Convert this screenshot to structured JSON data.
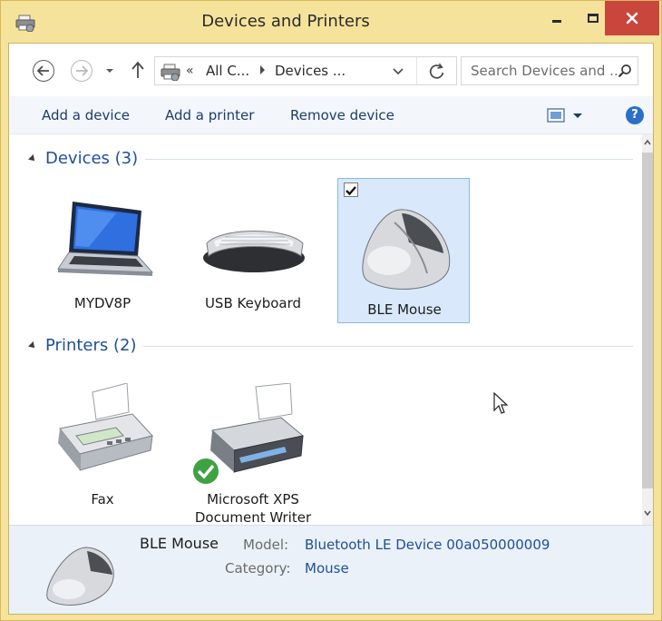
{
  "window": {
    "title": "Devices and Printers",
    "icons": [
      "devices-printers-icon",
      "minimize-icon",
      "maximize-icon",
      "close-icon"
    ],
    "close_color": "#c9463d",
    "frame_color": "#f6e39b"
  },
  "navigation": {
    "address_overflow": "«",
    "crumb_1": "All C...",
    "crumb_2": "Devices ...",
    "search_placeholder": "Search Devices and ..."
  },
  "commands": {
    "add_device": "Add a device",
    "add_printer": "Add a printer",
    "remove_device": "Remove device",
    "help_label": "?"
  },
  "groups": [
    {
      "label": "Devices (3)",
      "items": [
        {
          "label": "MYDV8P",
          "icon": "laptop-icon",
          "selected": false
        },
        {
          "label": "USB Keyboard",
          "icon": "keyboard-icon",
          "selected": false
        },
        {
          "label": "BLE Mouse",
          "icon": "mouse-icon",
          "selected": true
        }
      ]
    },
    {
      "label": "Printers (2)",
      "items": [
        {
          "label": "Fax",
          "icon": "fax-icon",
          "selected": false
        },
        {
          "label_line1": "Microsoft XPS",
          "label_line2": "Document Writer",
          "icon": "printer-icon",
          "default": true
        }
      ]
    }
  ],
  "details": {
    "name": "BLE Mouse",
    "model_key": "Model:",
    "model_value": "Bluetooth LE Device 00a050000009",
    "category_key": "Category:",
    "category_value": "Mouse"
  },
  "colors": {
    "accent_text": "#1e4f9a",
    "selection_fill": "#d9e9fb",
    "selection_border": "#87b8ec",
    "details_bg": "#eaf1f8"
  }
}
